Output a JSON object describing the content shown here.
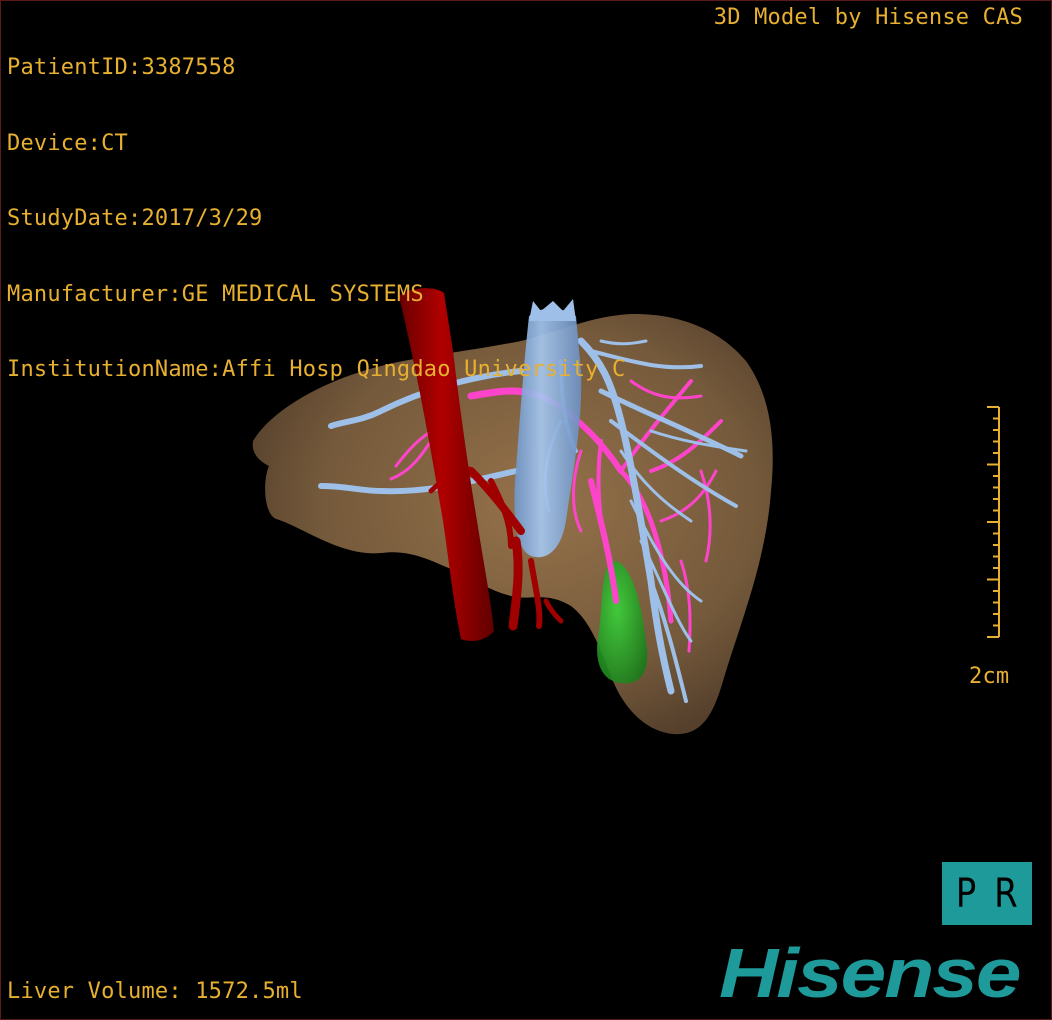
{
  "patient_info": {
    "patient_id": "PatientID:3387558",
    "device": "Device:CT",
    "study_date": "StudyDate:2017/3/29",
    "manufacturer": "Manufacturer:GE MEDICAL SYSTEMS",
    "institution": "InstitutionName:Affi Hosp Qingdao University C"
  },
  "credit": "3D Model by Hisense CAS",
  "liver_volume": "Liver Volume: 1572.5ml",
  "scale": {
    "label": "2cm"
  },
  "view_button": {
    "left": "P",
    "right": "R"
  },
  "logo_text": "Hisense",
  "colors": {
    "overlay_text": "#e8b030",
    "liver": "#8a6a45",
    "aorta": "#8b0000",
    "vena_cava": "#8ab4e8",
    "portal_vein": "#ff44cc",
    "gallbladder": "#22aa22",
    "brand_teal": "#1e9a9a"
  }
}
